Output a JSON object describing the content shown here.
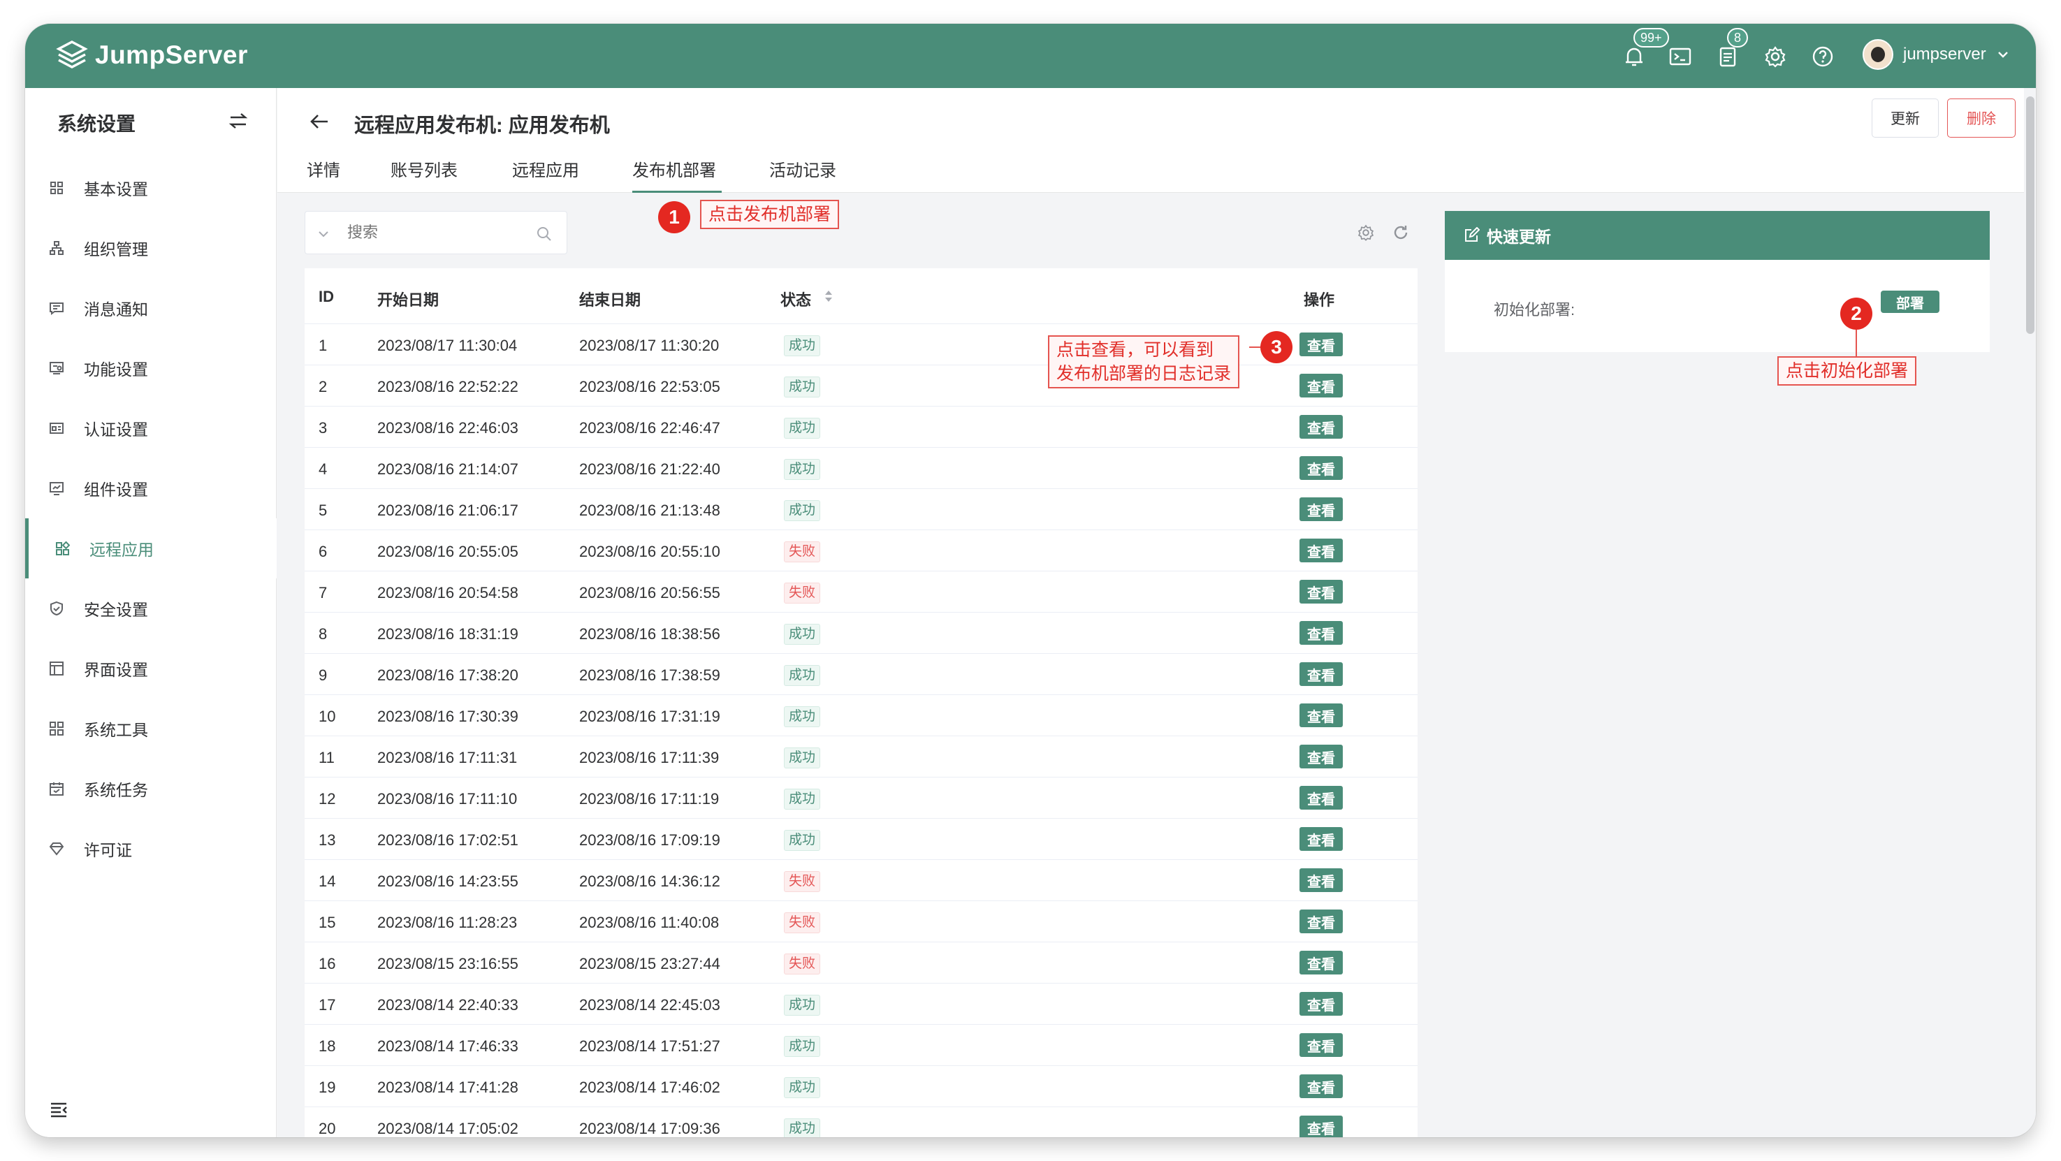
{
  "brand": {
    "name": "JumpServer"
  },
  "topbar": {
    "notify_badge": "99+",
    "tasks_badge": "8",
    "username": "jumpserver"
  },
  "sidebar": {
    "title": "系统设置",
    "items": [
      {
        "label": "基本设置",
        "icon": "grid-icon"
      },
      {
        "label": "组织管理",
        "icon": "org-icon"
      },
      {
        "label": "消息通知",
        "icon": "message-icon"
      },
      {
        "label": "功能设置",
        "icon": "feature-icon"
      },
      {
        "label": "认证设置",
        "icon": "auth-icon"
      },
      {
        "label": "组件设置",
        "icon": "monitor-icon"
      },
      {
        "label": "远程应用",
        "icon": "apps-icon",
        "active": true
      },
      {
        "label": "安全设置",
        "icon": "shield-icon"
      },
      {
        "label": "界面设置",
        "icon": "layout-icon"
      },
      {
        "label": "系统工具",
        "icon": "tools-icon"
      },
      {
        "label": "系统任务",
        "icon": "calendar-icon"
      },
      {
        "label": "许可证",
        "icon": "diamond-icon"
      }
    ]
  },
  "header": {
    "title": "远程应用发布机: 应用发布机",
    "update_label": "更新",
    "delete_label": "删除",
    "tabs": [
      {
        "label": "详情"
      },
      {
        "label": "账号列表"
      },
      {
        "label": "远程应用"
      },
      {
        "label": "发布机部署",
        "active": true
      },
      {
        "label": "活动记录"
      }
    ]
  },
  "search": {
    "placeholder": "搜索"
  },
  "table": {
    "columns": {
      "id": "ID",
      "start": "开始日期",
      "end": "结束日期",
      "status": "状态",
      "action": "操作"
    },
    "view_label": "查看",
    "rows": [
      {
        "id": "1",
        "start": "2023/08/17 11:30:04",
        "end": "2023/08/17 11:30:20",
        "status": "成功",
        "ok": true
      },
      {
        "id": "2",
        "start": "2023/08/16 22:52:22",
        "end": "2023/08/16 22:53:05",
        "status": "成功",
        "ok": true
      },
      {
        "id": "3",
        "start": "2023/08/16 22:46:03",
        "end": "2023/08/16 22:46:47",
        "status": "成功",
        "ok": true
      },
      {
        "id": "4",
        "start": "2023/08/16 21:14:07",
        "end": "2023/08/16 21:22:40",
        "status": "成功",
        "ok": true
      },
      {
        "id": "5",
        "start": "2023/08/16 21:06:17",
        "end": "2023/08/16 21:13:48",
        "status": "成功",
        "ok": true
      },
      {
        "id": "6",
        "start": "2023/08/16 20:55:05",
        "end": "2023/08/16 20:55:10",
        "status": "失败",
        "ok": false
      },
      {
        "id": "7",
        "start": "2023/08/16 20:54:58",
        "end": "2023/08/16 20:56:55",
        "status": "失败",
        "ok": false
      },
      {
        "id": "8",
        "start": "2023/08/16 18:31:19",
        "end": "2023/08/16 18:38:56",
        "status": "成功",
        "ok": true
      },
      {
        "id": "9",
        "start": "2023/08/16 17:38:20",
        "end": "2023/08/16 17:38:59",
        "status": "成功",
        "ok": true
      },
      {
        "id": "10",
        "start": "2023/08/16 17:30:39",
        "end": "2023/08/16 17:31:19",
        "status": "成功",
        "ok": true
      },
      {
        "id": "11",
        "start": "2023/08/16 17:11:31",
        "end": "2023/08/16 17:11:39",
        "status": "成功",
        "ok": true
      },
      {
        "id": "12",
        "start": "2023/08/16 17:11:10",
        "end": "2023/08/16 17:11:19",
        "status": "成功",
        "ok": true
      },
      {
        "id": "13",
        "start": "2023/08/16 17:02:51",
        "end": "2023/08/16 17:09:19",
        "status": "成功",
        "ok": true
      },
      {
        "id": "14",
        "start": "2023/08/16 14:23:55",
        "end": "2023/08/16 14:36:12",
        "status": "失败",
        "ok": false
      },
      {
        "id": "15",
        "start": "2023/08/16 11:28:23",
        "end": "2023/08/16 11:40:08",
        "status": "失败",
        "ok": false
      },
      {
        "id": "16",
        "start": "2023/08/15 23:16:55",
        "end": "2023/08/15 23:27:44",
        "status": "失败",
        "ok": false
      },
      {
        "id": "17",
        "start": "2023/08/14 22:40:33",
        "end": "2023/08/14 22:45:03",
        "status": "成功",
        "ok": true
      },
      {
        "id": "18",
        "start": "2023/08/14 17:46:33",
        "end": "2023/08/14 17:51:27",
        "status": "成功",
        "ok": true
      },
      {
        "id": "19",
        "start": "2023/08/14 17:41:28",
        "end": "2023/08/14 17:46:02",
        "status": "成功",
        "ok": true
      },
      {
        "id": "20",
        "start": "2023/08/14 17:05:02",
        "end": "2023/08/14 17:09:36",
        "status": "成功",
        "ok": true
      }
    ]
  },
  "quick_update": {
    "title": "快速更新",
    "init_label": "初始化部署:",
    "deploy_label": "部署"
  },
  "annotations": {
    "note1": "点击发布机部署",
    "note2": "点击初始化部署",
    "note3_line1": "点击查看，可以看到",
    "note3_line2": "发布机部署的日志记录",
    "n1": "1",
    "n2": "2",
    "n3": "3"
  },
  "colors": {
    "brand": "#4a8d79",
    "danger": "#e45656",
    "annotation": "#e42821"
  }
}
